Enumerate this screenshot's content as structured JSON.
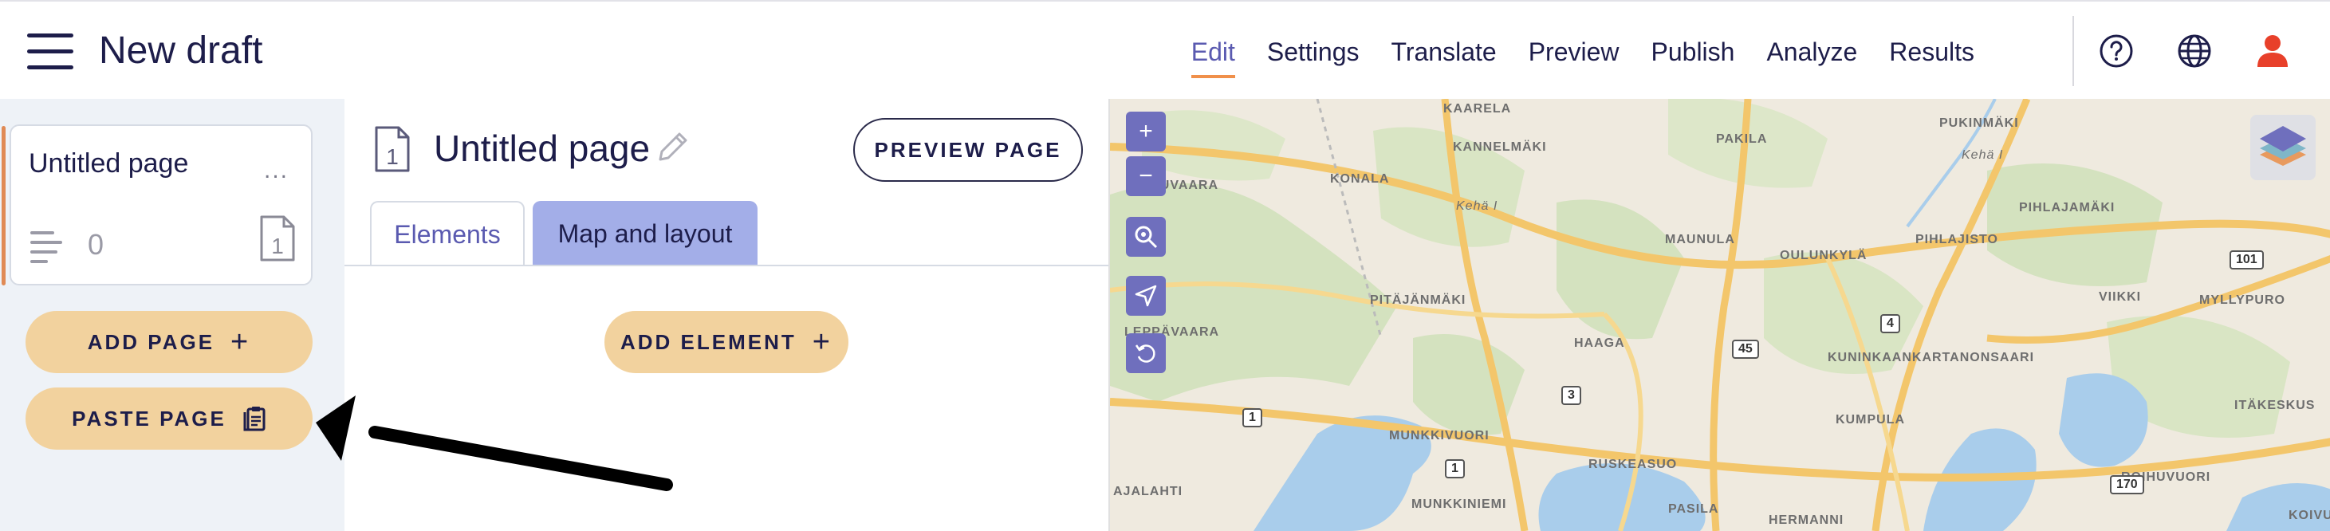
{
  "header": {
    "title": "New draft",
    "nav": [
      {
        "label": "Edit",
        "active": true
      },
      {
        "label": "Settings"
      },
      {
        "label": "Translate"
      },
      {
        "label": "Preview"
      },
      {
        "label": "Publish"
      },
      {
        "label": "Analyze"
      },
      {
        "label": "Results"
      }
    ],
    "icons": [
      "help-icon",
      "globe-icon",
      "user-icon"
    ],
    "accent_color": "#f0904a",
    "user_icon_color": "#e8402a"
  },
  "sidebar": {
    "page_card": {
      "title": "Untitled page",
      "element_count": "0",
      "page_number": "1",
      "menu": "..."
    },
    "add_page_label": "ADD PAGE",
    "paste_page_label": "PASTE PAGE",
    "button_color": "#f2d29e"
  },
  "editor": {
    "page_title": "Untitled page",
    "page_number": "1",
    "preview_label": "PREVIEW PAGE",
    "tabs": [
      {
        "label": "Elements",
        "active": true
      },
      {
        "label": "Map and layout"
      }
    ],
    "add_element_label": "ADD ELEMENT"
  },
  "map": {
    "controls": {
      "zoom_in": "+",
      "zoom_out": "−"
    },
    "places": [
      "KAARELA",
      "KANNELMÄKI",
      "PAKILA",
      "PUKINMÄKI",
      "Kehä I",
      "TUVAARA",
      "KONALA",
      "Kehä I",
      "MAUNULA",
      "PIHLAJAMÄKI",
      "PIHLAJISTO",
      "OULUNKYLÄ",
      "VIIKKI",
      "MYLLYPURO",
      "PITÄJÄNMÄKI",
      "LEPPÄVAARA",
      "HAAGA",
      "KUNINKAANKARTANONSAARI",
      "ITÄKESKUS",
      "MUNKKIVUORI",
      "KUMPULA",
      "RUSKEASUO",
      "AJALAHTI",
      "ROIHUVUORI",
      "MUNKKINIEMI",
      "PASILA",
      "HERMANNI",
      "KOIVU"
    ],
    "roads": [
      "101",
      "4",
      "45",
      "3",
      "1",
      "1",
      "170"
    ]
  }
}
